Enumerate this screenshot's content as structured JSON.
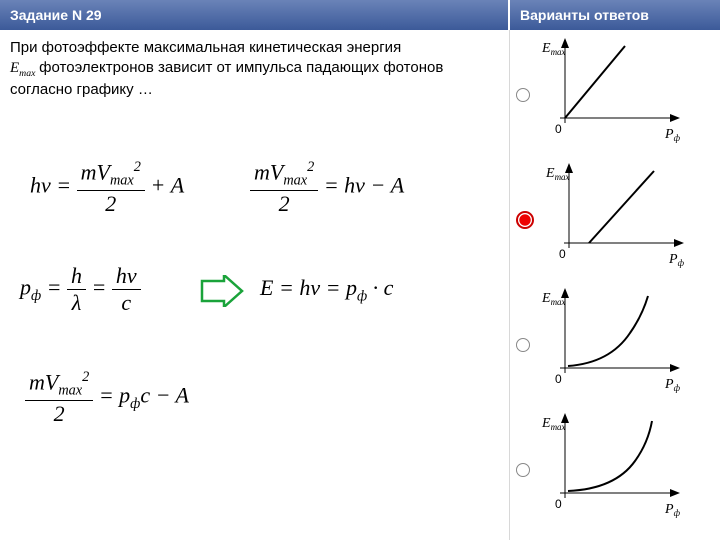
{
  "header": {
    "left": "Задание N 29",
    "right": "Варианты ответов"
  },
  "question": {
    "line1": "При фотоэффекте максимальная кинетическая энергия",
    "sym": "E",
    "sub": "max",
    "line2": " фотоэлектронов зависит от импульса падающих фотонов согласно графику …"
  },
  "eq": {
    "hnu": "hν",
    "mvfrac_top": "mV",
    "mvfrac_sup": "2",
    "mvfrac_sub": "max",
    "mvfrac_bot": "2",
    "plusA": " + A",
    "minusA": " −  A",
    "eqhnu": " = hν",
    "p_phi": "p",
    "phi": "ф",
    "h": "h",
    "lambda": "λ",
    "c": "c",
    "E": "E",
    "dotc": " · c",
    "pphic": "c"
  },
  "answers": {
    "ylabel": "E",
    "ysub": "max",
    "xlabel": "P",
    "xsub": "ф",
    "options": [
      {
        "type": "linear_origin",
        "selected": false
      },
      {
        "type": "linear_offset",
        "selected": true
      },
      {
        "type": "concave_up1",
        "selected": false
      },
      {
        "type": "concave_up2",
        "selected": false
      }
    ]
  }
}
